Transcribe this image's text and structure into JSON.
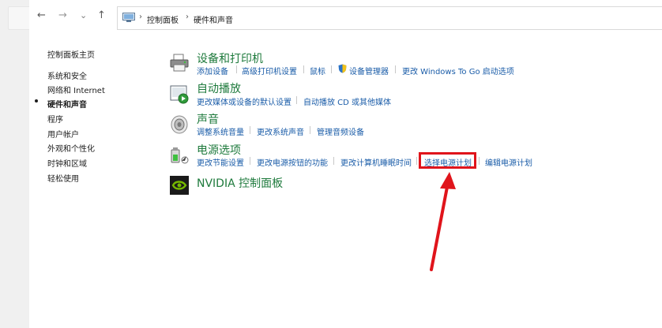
{
  "nav": {
    "back_glyph": "←",
    "forward_glyph": "→",
    "recent_glyph": "⌄",
    "up_glyph": "↑"
  },
  "breadcrumb": {
    "root": "控制面板",
    "current": "硬件和声音",
    "separator": "›"
  },
  "sidebar": {
    "items": [
      {
        "label": "控制面板主页"
      },
      {
        "label": "系统和安全"
      },
      {
        "label": "网络和 Internet"
      },
      {
        "label": "硬件和声音"
      },
      {
        "label": "程序"
      },
      {
        "label": "用户帐户"
      },
      {
        "label": "外观和个性化"
      },
      {
        "label": "时钟和区域"
      },
      {
        "label": "轻松使用"
      }
    ]
  },
  "categories": {
    "devices": {
      "title": "设备和打印机",
      "links": [
        "添加设备",
        "高级打印机设置",
        "鼠标",
        "设备管理器",
        "更改 Windows To Go 启动选项"
      ]
    },
    "autoplay": {
      "title": "自动播放",
      "links": [
        "更改媒体或设备的默认设置",
        "自动播放 CD 或其他媒体"
      ]
    },
    "sound": {
      "title": "声音",
      "links": [
        "调整系统音量",
        "更改系统声音",
        "管理音频设备"
      ]
    },
    "power": {
      "title": "电源选项",
      "links": [
        "更改节能设置",
        "更改电源按钮的功能",
        "更改计算机睡眠时间",
        "选择电源计划",
        "编辑电源计划"
      ]
    },
    "nvidia": {
      "title": "NVIDIA 控制面板"
    }
  },
  "colors": {
    "category_title": "#1e7a3c",
    "link": "#1a5ca8",
    "annotation": "#e0141b"
  },
  "icons": [
    "printer-icon",
    "autoplay-icon",
    "speaker-icon",
    "power-options-icon",
    "nvidia-icon",
    "shield-icon",
    "control-panel-icon"
  ]
}
